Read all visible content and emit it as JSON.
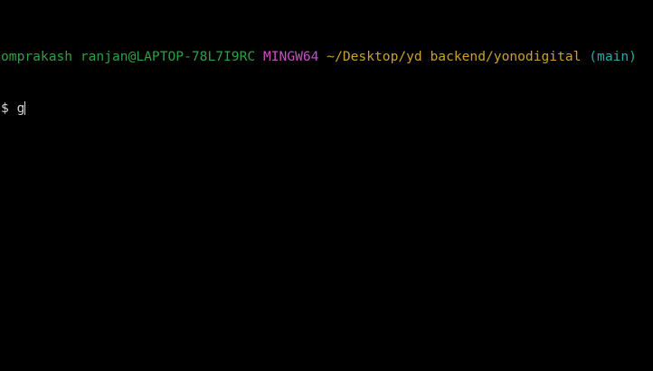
{
  "terminal": {
    "prompt": {
      "user_host": "omprakash ranjan@LAPTOP-78L7I9RC",
      "system": "MINGW64",
      "path": "~/Desktop/yd backend/yonodigital",
      "branch": "(main)"
    },
    "input_line": {
      "prompt_symbol": "$",
      "command_text": "g"
    }
  },
  "colors": {
    "background": "#000000",
    "user_host": "#2ea043",
    "system": "#c94fc9",
    "path": "#c9a227",
    "branch": "#2aa8a8",
    "text": "#d8d8d8"
  }
}
